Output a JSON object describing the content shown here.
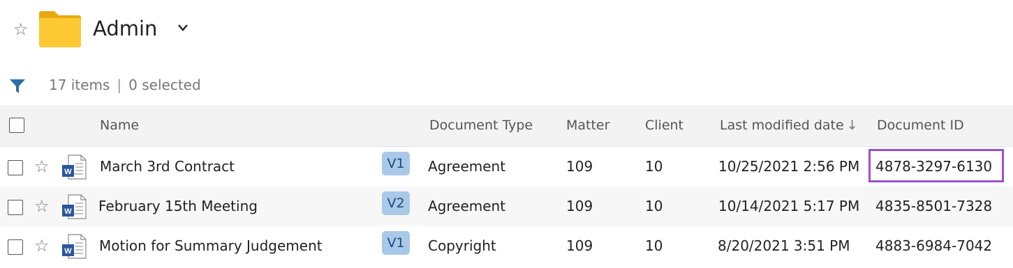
{
  "header": {
    "title": "Admin",
    "star_icon": "star-outline-icon",
    "folder_color": "#f9c22e"
  },
  "toolbar": {
    "items_count": "17 items",
    "separator": "|",
    "selected_count": "0 selected",
    "filter_color": "#2e6fa7"
  },
  "table": {
    "columns": {
      "name": "Name",
      "document_type": "Document Type",
      "matter": "Matter",
      "client": "Client",
      "last_modified": "Last modified date",
      "sort_indicator": "↓",
      "document_id": "Document ID"
    },
    "rows": [
      {
        "name": "March 3rd Contract",
        "version": "V1",
        "document_type": "Agreement",
        "matter": "109",
        "client": "10",
        "last_modified": "10/25/2021 2:56 PM",
        "document_id": "4878-3297-6130",
        "highlighted": true
      },
      {
        "name": "February 15th Meeting",
        "version": "V2",
        "document_type": "Agreement",
        "matter": "109",
        "client": "10",
        "last_modified": "10/14/2021 5:17 PM",
        "document_id": "4835-8501-7328"
      },
      {
        "name": "Motion for Summary Judgement",
        "version": "V1",
        "document_type": "Copyright",
        "matter": "109",
        "client": "10",
        "last_modified": "8/20/2021 3:51 PM",
        "document_id": "4883-6984-7042"
      }
    ]
  },
  "colors": {
    "version_badge": "#a9c9e8",
    "highlight_border": "#9a4fd1",
    "word_blue": "#2b579a"
  }
}
